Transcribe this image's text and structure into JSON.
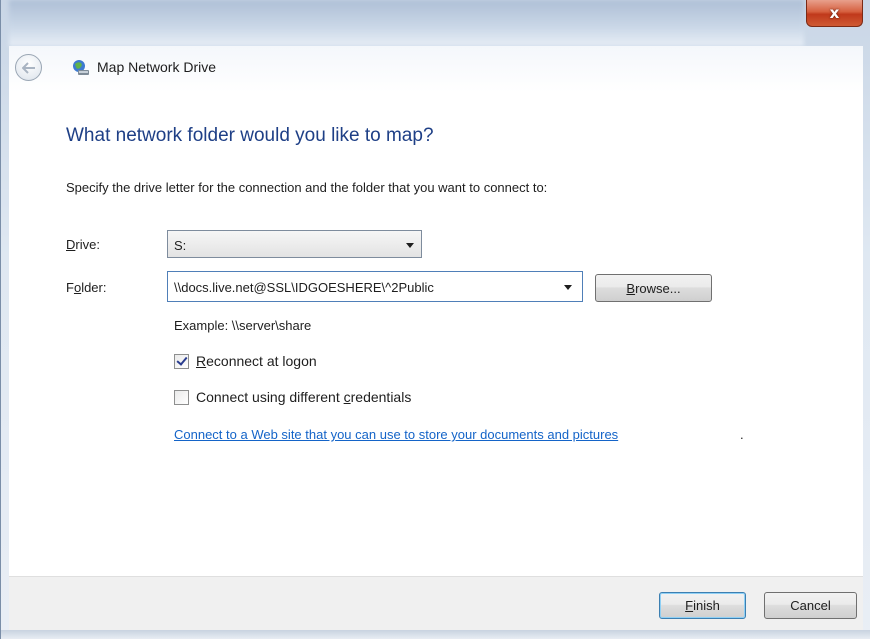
{
  "window": {
    "title": "Map Network Drive",
    "close_glyph": "x"
  },
  "main": {
    "heading": "What network folder would you like to map?",
    "subtitle": "Specify the drive letter for the connection and the folder that you want to connect to:"
  },
  "drive": {
    "label": "Drive:",
    "value": "S:"
  },
  "folder": {
    "label": "Folder:",
    "value": "\\\\docs.live.net@SSL\\IDGOESHERE\\^2Public",
    "browse_label": "Browse..."
  },
  "example": "Example: \\\\server\\share",
  "options": {
    "reconnect": {
      "label": "Reconnect at logon",
      "checked": true
    },
    "credentials": {
      "label": "Connect using different credentials",
      "checked": false
    }
  },
  "link": {
    "text": "Connect to a Web site that you can use to store your documents and pictures",
    "trailing": "."
  },
  "footer": {
    "finish_label": "Finish",
    "cancel_label": "Cancel"
  },
  "icons": {
    "back": "back-arrow-icon",
    "network": "network-drive-icon",
    "dropdown": "chevron-down-icon"
  },
  "colors": {
    "heading": "#1e3f86",
    "link": "#1464c8",
    "close": "#c0391b"
  }
}
